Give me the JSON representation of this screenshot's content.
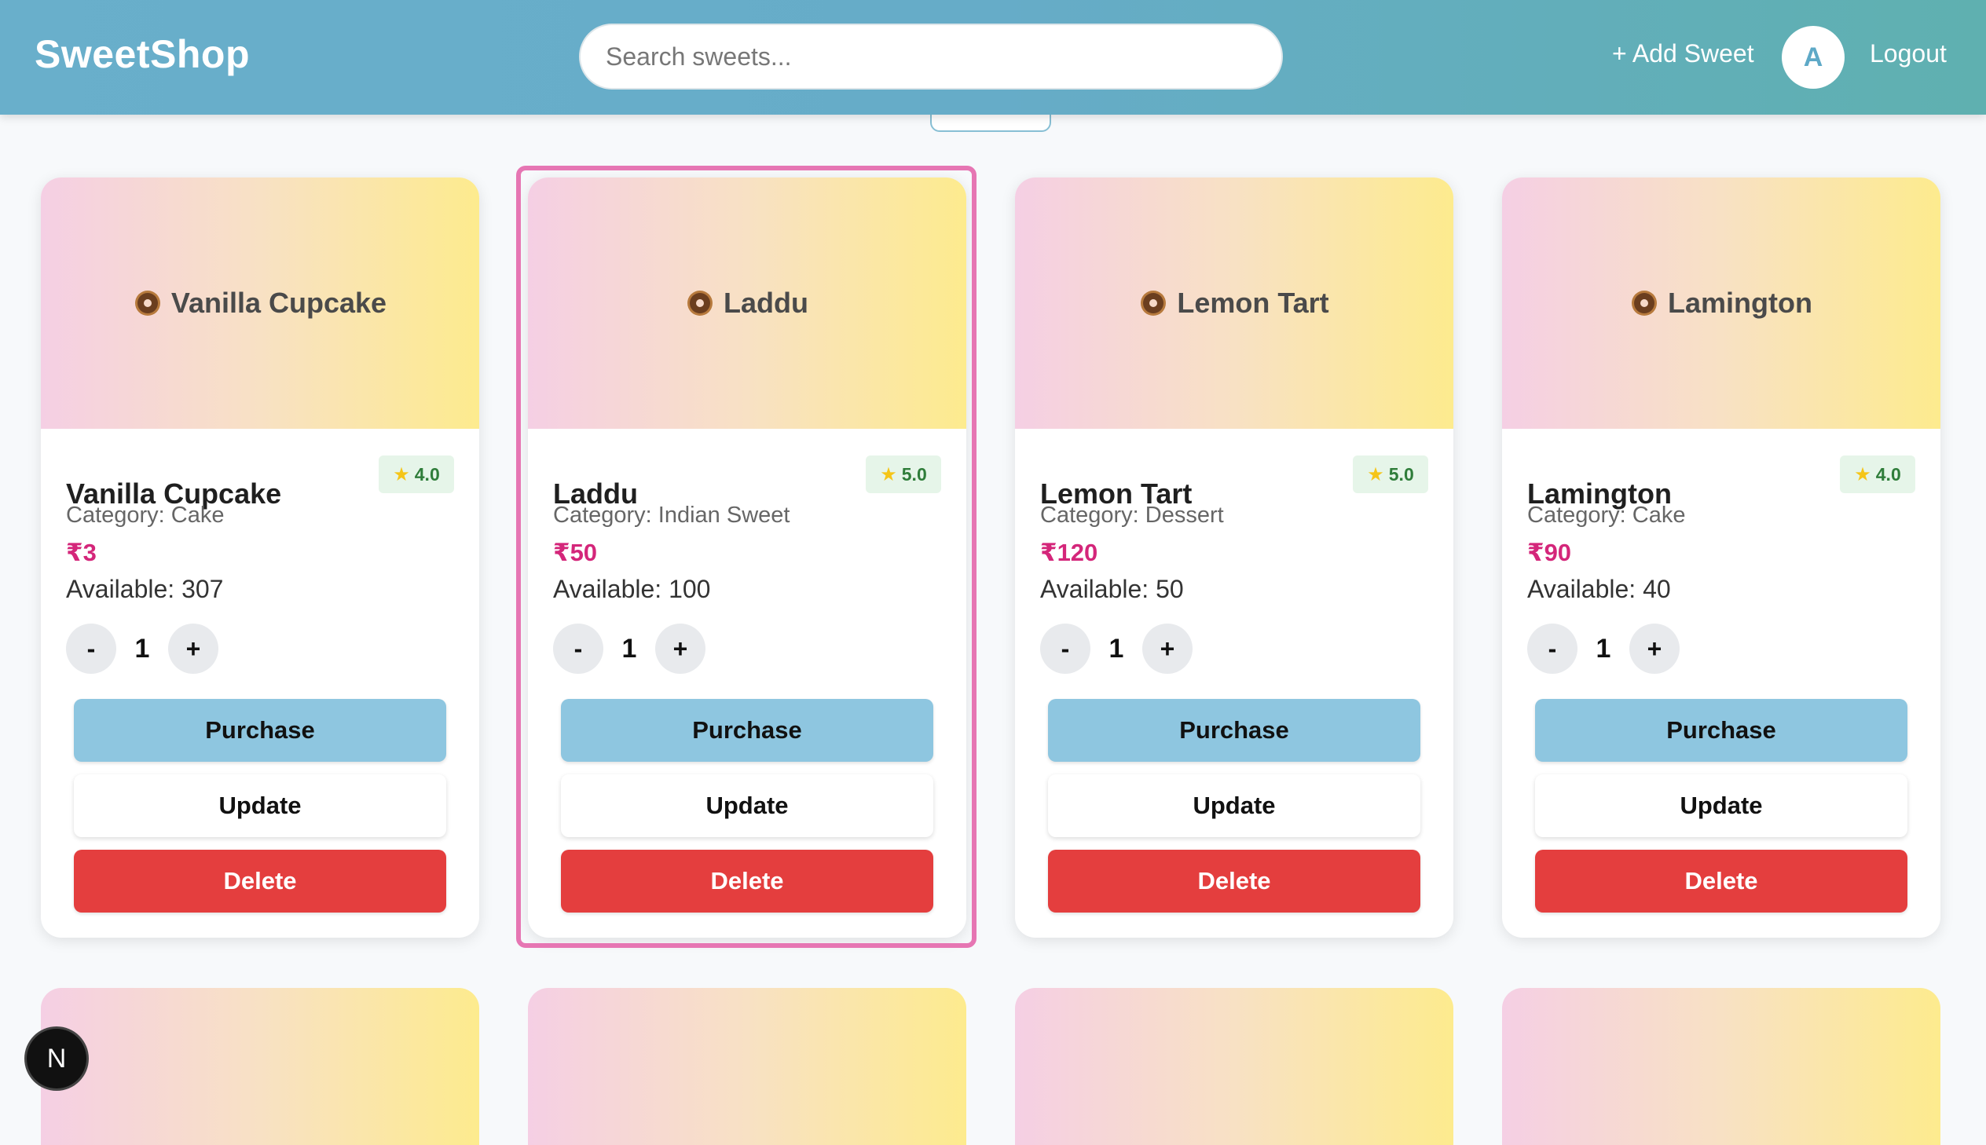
{
  "header": {
    "brand": "SweetShop",
    "search_placeholder": "Search sweets...",
    "add_sweet_label": "+ Add Sweet",
    "avatar_initial": "A",
    "logout_label": "Logout"
  },
  "labels": {
    "purchase": "Purchase",
    "update": "Update",
    "delete": "Delete",
    "minus": "-",
    "plus": "+"
  },
  "cards": [
    {
      "name": "Vanilla Cupcake",
      "banner": "Vanilla Cupcake",
      "rating": "4.0",
      "category": "Category: Cake",
      "price": "₹3",
      "available": "Available: 307",
      "qty": "1"
    },
    {
      "name": "Laddu",
      "banner": "Laddu",
      "rating": "5.0",
      "category": "Category: Indian Sweet",
      "price": "₹50",
      "available": "Available: 100",
      "qty": "1"
    },
    {
      "name": "Lemon Tart",
      "banner": "Lemon Tart",
      "rating": "5.0",
      "category": "Category: Dessert",
      "price": "₹120",
      "available": "Available: 50",
      "qty": "1"
    },
    {
      "name": "Lamington",
      "banner": "Lamington",
      "rating": "4.0",
      "category": "Category: Cake",
      "price": "₹90",
      "available": "Available: 40",
      "qty": "1"
    }
  ],
  "badge": {
    "letter": "N"
  },
  "colors": {
    "header_start": "#69afcb",
    "header_end": "#5fb0b0",
    "price": "#d4267a",
    "purchase": "#8ec6e0",
    "delete": "#e43e3e",
    "highlight": "#e676b3"
  }
}
